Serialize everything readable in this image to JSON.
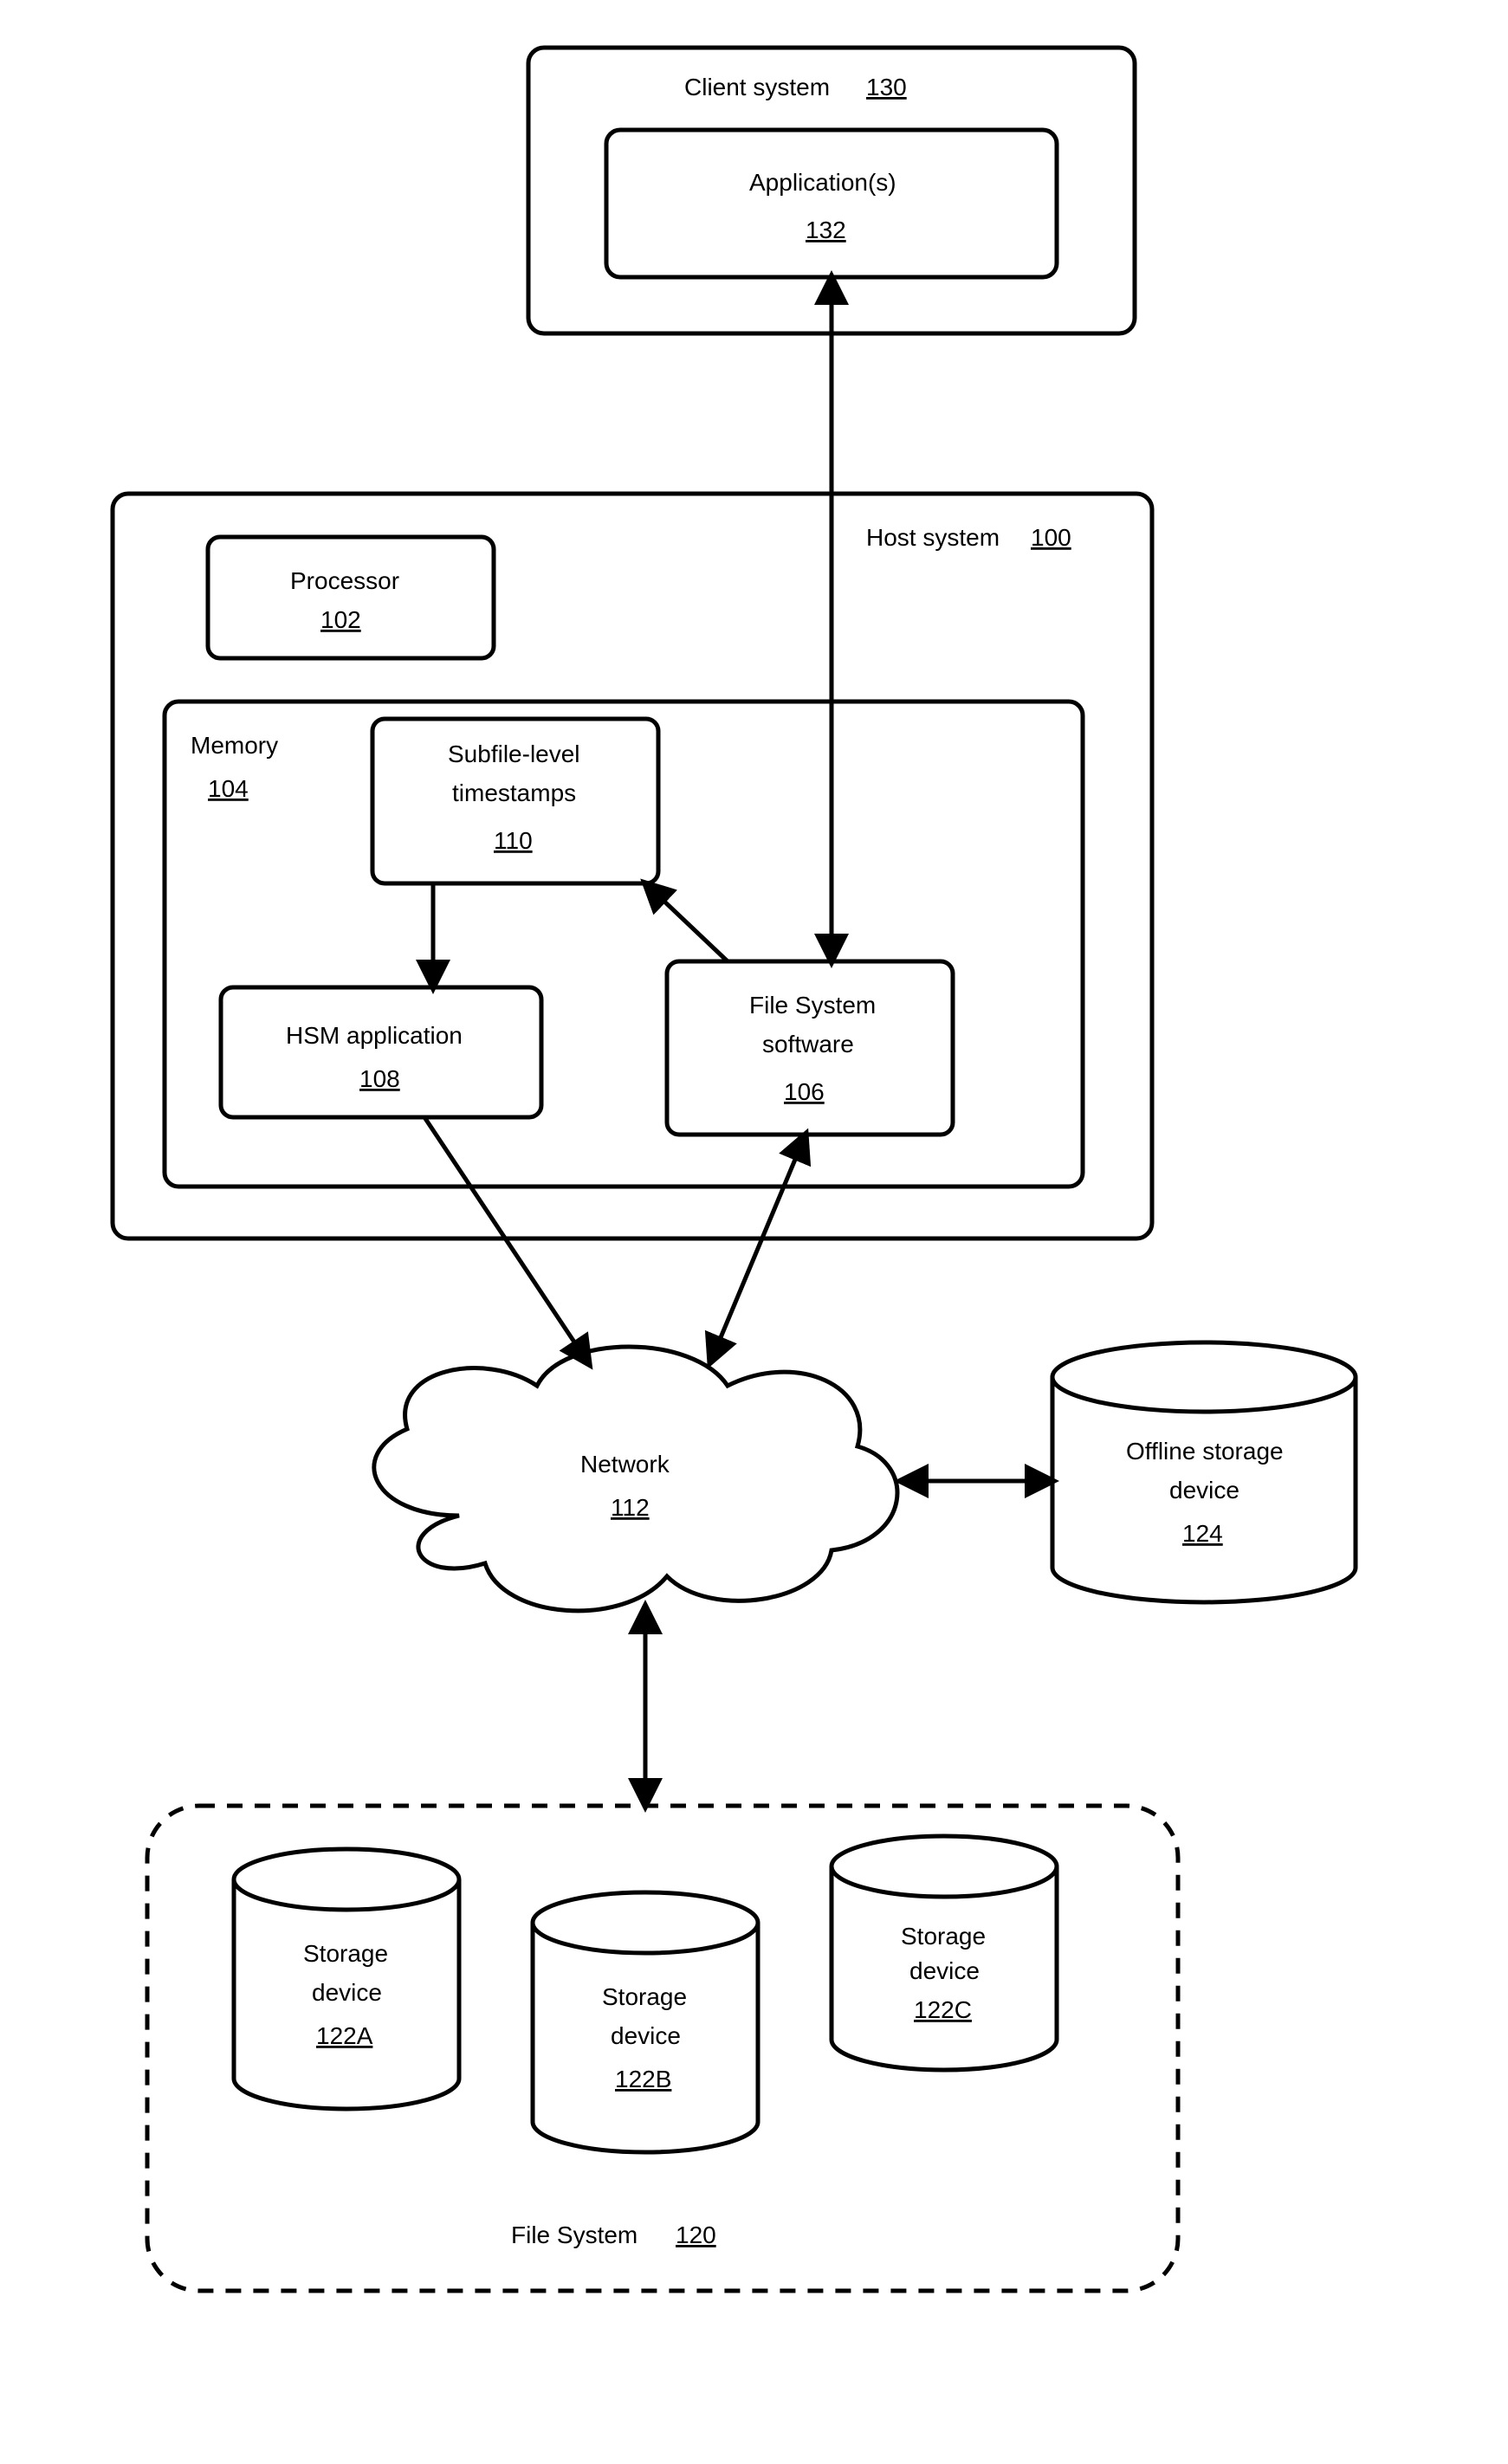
{
  "client": {
    "label": "Client system",
    "ref": "130"
  },
  "apps": {
    "label": "Application(s)",
    "ref": "132"
  },
  "host": {
    "label": "Host system",
    "ref": "100"
  },
  "proc": {
    "label": "Processor",
    "ref": "102"
  },
  "mem": {
    "label": "Memory",
    "ref": "104"
  },
  "subfile": {
    "line1": "Subfile-level",
    "line2": "timestamps",
    "ref": "110"
  },
  "hsm": {
    "label": "HSM application",
    "ref": "108"
  },
  "fss": {
    "line1": "File System",
    "line2": "software",
    "ref": "106"
  },
  "net": {
    "label": "Network",
    "ref": "112"
  },
  "off": {
    "line1": "Offline storage",
    "line2": "device",
    "ref": "124"
  },
  "sdA": {
    "line1": "Storage",
    "line2": "device",
    "ref": "122A"
  },
  "sdB": {
    "line1": "Storage",
    "line2": "device",
    "ref": "122B"
  },
  "sdC": {
    "line1": "Storage",
    "line2": "device",
    "ref": "122C"
  },
  "fs": {
    "label": "File System",
    "ref": "120"
  }
}
